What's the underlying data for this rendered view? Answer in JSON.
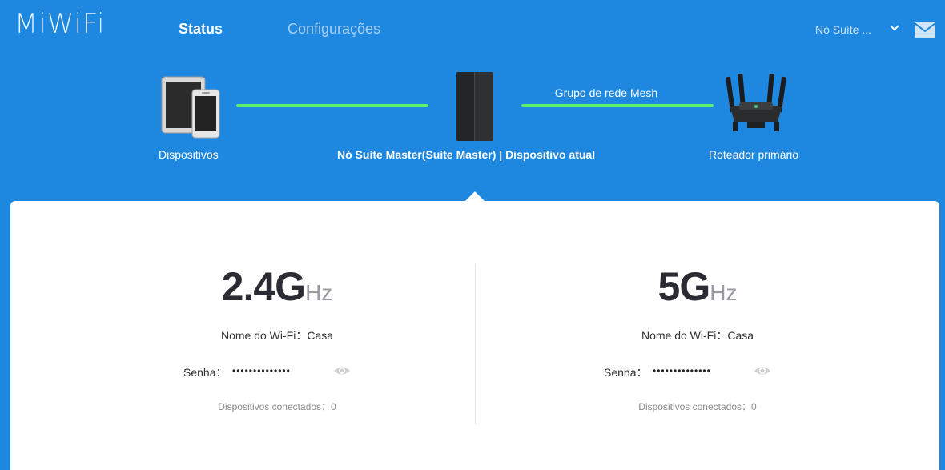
{
  "header": {
    "logo": "MiWiFi",
    "nav": {
      "status": "Status",
      "config": "Configurações"
    },
    "node_selector": "Nó Suíte ...",
    "icons": {
      "dropdown": "chevron-down-icon",
      "messages": "mail-icon"
    }
  },
  "topology": {
    "devices_label": "Dispositivos",
    "mesh_label": "Grupo de rede Mesh",
    "node_label": "Nó Suíte Master(Suíte Master) | Dispositivo atual",
    "router_label": "Roteador primário",
    "link_color": "#5ff06a"
  },
  "bands": [
    {
      "freq": "2.4G",
      "unit": "Hz",
      "name_label": "Nome do Wi-Fi：",
      "name_value": "Casa",
      "password_label": "Senha：",
      "password_mask": "••••••••••••••",
      "connected_label": "Dispositivos conectados：",
      "connected_count": "0"
    },
    {
      "freq": "5G",
      "unit": "Hz",
      "name_label": "Nome do Wi-Fi：",
      "name_value": "Casa",
      "password_label": "Senha：",
      "password_mask": "••••••••••••••",
      "connected_label": "Dispositivos conectados：",
      "connected_count": "0"
    }
  ],
  "colors": {
    "background": "#1e88e0",
    "panel": "#ffffff",
    "active_nav": "#ffffff",
    "inactive_nav": "#a8cff3"
  }
}
